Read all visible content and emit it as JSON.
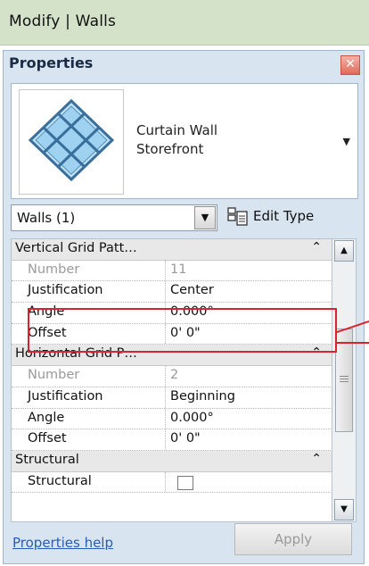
{
  "ribbon": {
    "title": "Modify | Walls"
  },
  "palette": {
    "title": "Properties",
    "close_glyph": "✕",
    "type_selector": {
      "name_line1": "Curtain Wall",
      "name_line2": "Storefront",
      "dropdown_glyph": "▼",
      "thumbnail_icon": "curtain-wall-icon"
    },
    "filter": {
      "value": "Walls (1)",
      "button_glyph": "▼"
    },
    "edit_type": {
      "label": "Edit Type",
      "icon": "edit-type-icon"
    }
  },
  "properties": {
    "group_vertical": {
      "title": "Vertical Grid Patt…",
      "collapse_glyph": "⌃",
      "rows": [
        {
          "name": "Number",
          "value": "11",
          "disabled": true
        },
        {
          "name": "Justification",
          "value": "Center"
        },
        {
          "name": "Angle",
          "value": "0.000°"
        },
        {
          "name": "Offset",
          "value": "0'  0\""
        }
      ]
    },
    "group_horizontal": {
      "title": "Horizontal Grid P…",
      "collapse_glyph": "⌃",
      "rows": [
        {
          "name": "Number",
          "value": "2",
          "disabled": true
        },
        {
          "name": "Justification",
          "value": "Beginning"
        },
        {
          "name": "Angle",
          "value": "0.000°"
        },
        {
          "name": "Offset",
          "value": "0'  0\""
        }
      ]
    },
    "group_structural": {
      "title": "Structural",
      "collapse_glyph": "⌃",
      "first_row_name": "Structural"
    }
  },
  "scrollbar": {
    "up_glyph": "▲",
    "down_glyph": "▼"
  },
  "footer": {
    "help_link": "Properties help",
    "apply_label": "Apply"
  },
  "colors": {
    "highlight": "#d9232d",
    "ribbon": "#d4e2c9",
    "palette": "#d8e4ef"
  }
}
